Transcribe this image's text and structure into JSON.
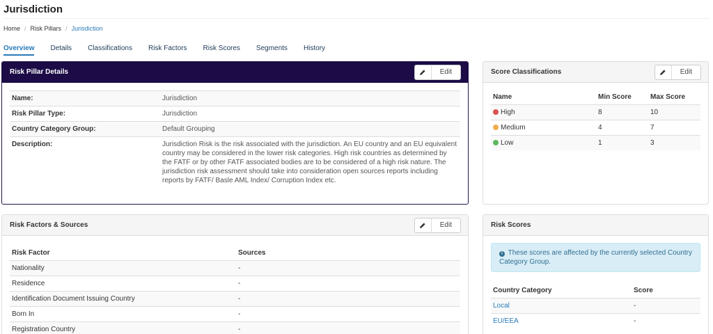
{
  "page": {
    "title": "Jurisdiction"
  },
  "breadcrumb": {
    "items": [
      "Home",
      "Risk Pillars",
      "Jurisdiction"
    ]
  },
  "tabs": [
    "Overview",
    "Details",
    "Classifications",
    "Risk Factors",
    "Risk Scores",
    "Segments",
    "History"
  ],
  "edit_label": "Edit",
  "risk_pillar_details": {
    "title": "Risk Pillar Details",
    "rows": [
      {
        "key": "Name:",
        "value": "Jurisdiction"
      },
      {
        "key": "Risk Pillar Type:",
        "value": "Jurisdiction"
      },
      {
        "key": "Country Category Group:",
        "value": "Default Grouping"
      },
      {
        "key": "Description:",
        "value": "Jurisdiction Risk is the risk associated with the jurisdiction. An EU country and an EU equivalent country may be considered in the lower risk categories. High risk countries as determined by the FATF or by other FATF associated bodies are to be considered of a high risk nature. The jurisdiction risk assessment should take into consideration open sources reports including reports by FATF/ Basle AML Index/ Corruption Index etc."
      }
    ]
  },
  "score_classifications": {
    "title": "Score Classifications",
    "headers": [
      "Name",
      "Min Score",
      "Max Score"
    ],
    "rows": [
      {
        "name": "High",
        "min": "8",
        "max": "10",
        "color": "#d9534f"
      },
      {
        "name": "Medium",
        "min": "4",
        "max": "7",
        "color": "#f0ad4e"
      },
      {
        "name": "Low",
        "min": "1",
        "max": "3",
        "color": "#5cb85c"
      }
    ]
  },
  "risk_factors": {
    "title": "Risk Factors & Sources",
    "headers": [
      "Risk Factor",
      "Sources"
    ],
    "rows": [
      {
        "factor": "Nationality",
        "sources": "-"
      },
      {
        "factor": "Residence",
        "sources": "-"
      },
      {
        "factor": "Identification Document Issuing Country",
        "sources": "-"
      },
      {
        "factor": "Born In",
        "sources": "-"
      },
      {
        "factor": "Registration Country",
        "sources": "-"
      }
    ]
  },
  "risk_scores": {
    "title": "Risk Scores",
    "alert": "These scores are affected by the currently selected Country Category Group.",
    "headers": [
      "Country Category",
      "Score"
    ],
    "rows": [
      {
        "category": "Local",
        "score": "-"
      },
      {
        "category": "EU/EEA",
        "score": "-"
      }
    ]
  },
  "colors": {
    "primary_header": "#1c0b46",
    "link": "#2a7ab8"
  }
}
